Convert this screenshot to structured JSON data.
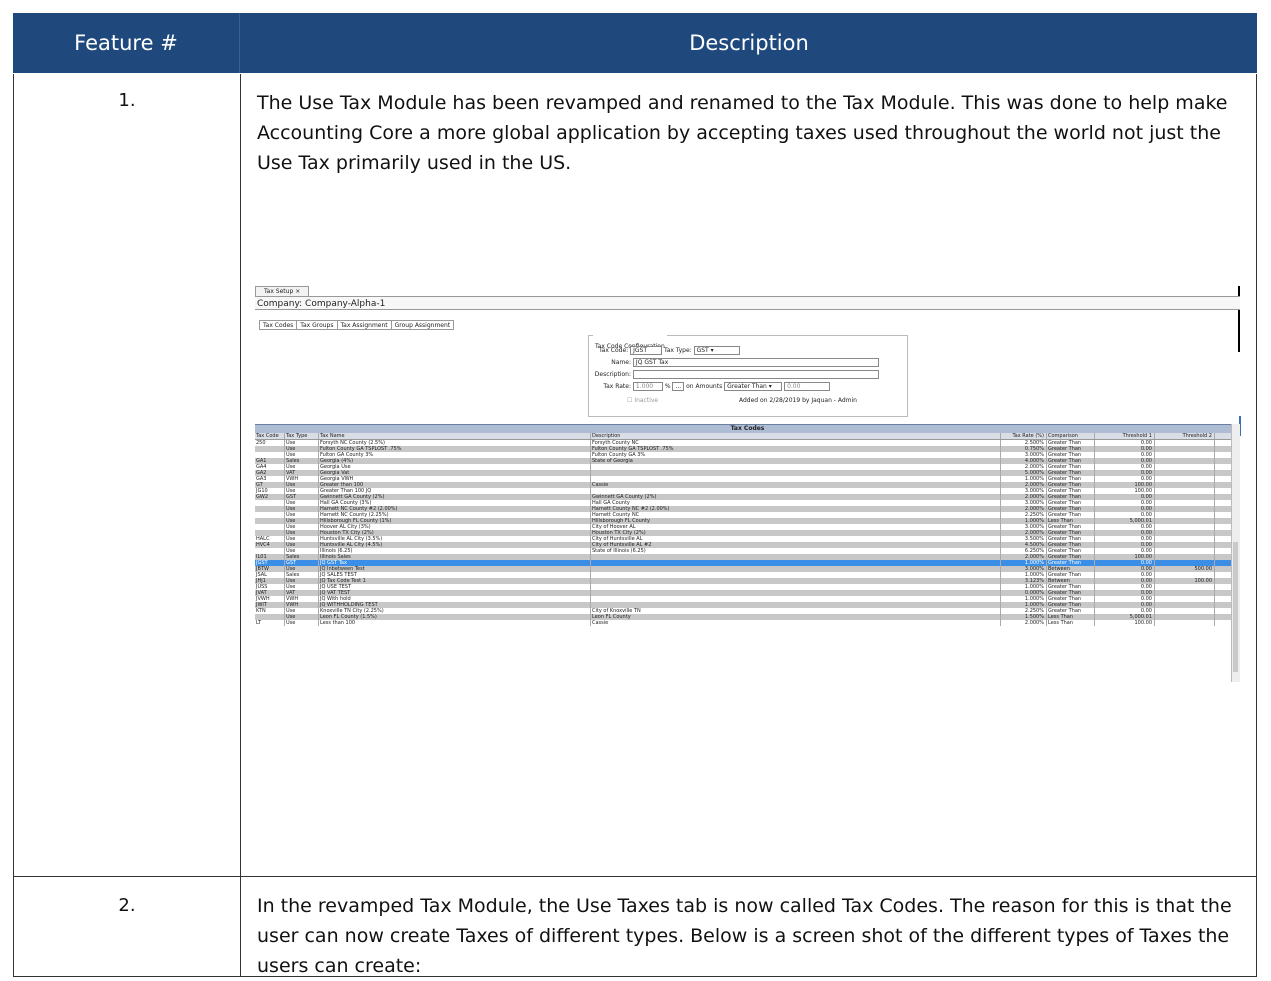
{
  "header": {
    "col1": "Feature #",
    "col2": "Description"
  },
  "rows": [
    {
      "num": "1.",
      "text": "The Use Tax Module has been revamped and renamed to the Tax Module. This was done to help make Accounting Core a more global application by accepting taxes used throughout the world not just the Use Tax primarily used in the US."
    },
    {
      "num": "2.",
      "text": "In the revamped Tax Module, the Use Taxes tab is now called Tax Codes. The reason for this is that the user can now create Taxes of different types. Below is a screen shot of the different types of Taxes the users can create:"
    }
  ],
  "screenshot": {
    "tab": "Tax Setup",
    "company": "Company: Company-Alpha-1",
    "subtabs": [
      "Tax Codes",
      "Tax Groups",
      "Tax Assignment",
      "Group Assignment"
    ],
    "config": {
      "legend": "Tax Code Configuration",
      "tax_code_label": "Tax Code:",
      "tax_code": "JGST",
      "tax_type_label": "Tax Type:",
      "tax_type": "GST",
      "name_label": "Name:",
      "name": "JQ GST Tax",
      "desc_label": "Description:",
      "desc": "",
      "rate_label": "Tax Rate:",
      "rate": "1.000",
      "pct": "%",
      "dots": "...",
      "amounts_label": "on Amounts",
      "amounts": "Greater Than",
      "amount_val": "0.00",
      "inactive": "Inactive",
      "added": "Added on 2/28/2019 by Jaquan - Admin"
    },
    "grid_title": "Tax Codes",
    "columns": [
      "Tax Code",
      "Tax Type",
      "Tax Name",
      "Description",
      "Tax Rate (%)",
      "Comparison",
      "Threshold 1",
      "Threshold 2"
    ],
    "rows": [
      [
        "250",
        "Use",
        "Forsyth NC County (2.5%)",
        "Forsyth County NC",
        "2.500%",
        "Greater Than",
        "0.00",
        ""
      ],
      [
        "",
        "Use",
        "Fulton County GA TSPLOST .75%",
        "Fulton County GA TSPLOST .75%",
        "0.750%",
        "Greater Than",
        "0.00",
        ""
      ],
      [
        "",
        "Use",
        "Fulton GA County 3%",
        "Fulton County GA 3%",
        "3.000%",
        "Greater Than",
        "0.00",
        ""
      ],
      [
        "GA1",
        "Sales",
        "Georgia (4%)",
        "State of Georgia",
        "4.000%",
        "Greater Than",
        "0.00",
        ""
      ],
      [
        "GA4",
        "Use",
        "Georgia Use",
        "",
        "2.000%",
        "Greater Than",
        "0.00",
        ""
      ],
      [
        "GA2",
        "VAT",
        "Georgia Vat",
        "",
        "5.000%",
        "Greater Than",
        "0.00",
        ""
      ],
      [
        "GA3",
        "VWH",
        "Georgia VWH",
        "",
        "1.000%",
        "Greater Than",
        "0.00",
        ""
      ],
      [
        "GT",
        "Use",
        "Greater than 100",
        "Cassie",
        "2.000%",
        "Greater Than",
        "100.00",
        ""
      ],
      [
        "JG10",
        "Use",
        "Greater Than 100 JQ",
        "",
        "3.000%",
        "Greater Than",
        "100.00",
        ""
      ],
      [
        "GW2",
        "GST",
        "Gwinnett GA County (2%)",
        "Gwinnett GA County (2%)",
        "2.000%",
        "Greater Than",
        "0.00",
        ""
      ],
      [
        "",
        "Use",
        "Hall GA County (3%)",
        "Hall GA County",
        "3.000%",
        "Greater Than",
        "0.00",
        ""
      ],
      [
        "",
        "Use",
        "Harnett NC County #2 (2.00%)",
        "Harnett County NC #2 (2.00%)",
        "2.000%",
        "Greater Than",
        "0.00",
        ""
      ],
      [
        "",
        "Use",
        "Harnett NC County (2.25%)",
        "Harnett County NC",
        "2.250%",
        "Greater Than",
        "0.00",
        ""
      ],
      [
        "",
        "Use",
        "Hillsborough FL County (1%)",
        "Hillsborough FL County",
        "1.000%",
        "Less Than",
        "5,000.01",
        ""
      ],
      [
        "",
        "Use",
        "Hoover AL City (3%)",
        "City of Hoover AL",
        "3.000%",
        "Greater Than",
        "0.00",
        ""
      ],
      [
        "",
        "Use",
        "Houston TX City (2%)",
        "Houston TX City (2%)",
        "2.000%",
        "Greater Than",
        "0.00",
        ""
      ],
      [
        "HALC",
        "Use",
        "Huntsville AL City (3.5%)",
        "City of Huntsville AL",
        "3.500%",
        "Greater Than",
        "0.00",
        ""
      ],
      [
        "HVC4",
        "Use",
        "Huntsville AL City (4.5%)",
        "City of Huntsville AL #2",
        "4.500%",
        "Greater Than",
        "0.00",
        ""
      ],
      [
        "",
        "Use",
        "Illinois (6.25)",
        "State of Illinois (6.25)",
        "6.250%",
        "Greater Than",
        "0.00",
        ""
      ],
      [
        "IL01",
        "Sales",
        "Illinois Sales",
        "",
        "2.000%",
        "Greater Than",
        "100.00",
        ""
      ],
      [
        "JGST",
        "GST",
        "JQ GST Tax",
        "",
        "1.000%",
        "Greater Than",
        "0.00",
        ""
      ],
      [
        "JBTW",
        "Use",
        "JQ Inbetween Test",
        "",
        "3.000%",
        "Between",
        "0.00",
        "500.00"
      ],
      [
        "JSAL",
        "Sales",
        "JQ SALES TEST",
        "",
        "1.000%",
        "Greater Than",
        "0.00",
        ""
      ],
      [
        "JHJ1",
        "Use",
        "JQ Tax Code Test 1",
        "",
        "3.123%",
        "Between",
        "0.00",
        "100.00"
      ],
      [
        "JUSS",
        "Use",
        "JQ USE TEST",
        "",
        "1.000%",
        "Greater Than",
        "0.00",
        ""
      ],
      [
        "JVAT",
        "VAT",
        "JQ VAT TEST",
        "",
        "0.000%",
        "Greater Than",
        "0.00",
        ""
      ],
      [
        "JVWH",
        "VWH",
        "JQ With hold",
        "",
        "1.000%",
        "Greater Than",
        "0.00",
        ""
      ],
      [
        "JWIT",
        "VWH",
        "JQ WITHHOLDING TEST",
        "",
        "1.000%",
        "Greater Than",
        "0.00",
        ""
      ],
      [
        "KTN",
        "Use",
        "Knoxville TN City (2.25%)",
        "City of Knoxville TN",
        "2.250%",
        "Greater Than",
        "0.00",
        ""
      ],
      [
        "",
        "Use",
        "Leon FL County (1.5%)",
        "Leon FL County",
        "1.500%",
        "Less Than",
        "5,000.01",
        ""
      ],
      [
        "LT",
        "Use",
        "Less than 100",
        "Cassie",
        "2.000%",
        "Less Than",
        "100.00",
        ""
      ]
    ],
    "selected_row": 20
  }
}
